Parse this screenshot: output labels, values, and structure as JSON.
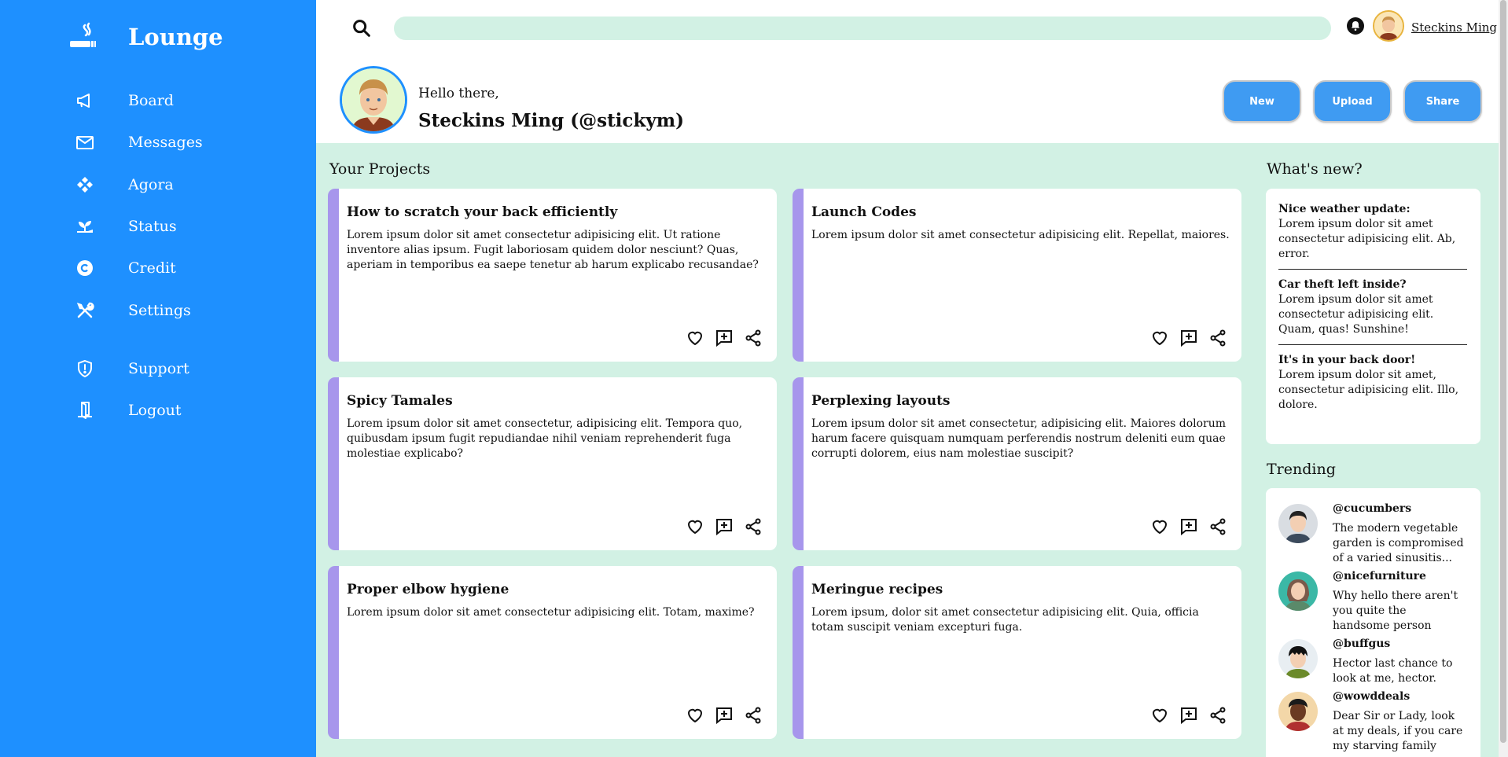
{
  "sidebar": {
    "brand": "Lounge",
    "items": [
      {
        "label": "Board",
        "icon": "megaphone-icon"
      },
      {
        "label": "Messages",
        "icon": "envelope-icon"
      },
      {
        "label": "Agora",
        "icon": "diamonds-icon"
      },
      {
        "label": "Status",
        "icon": "sprout-icon"
      },
      {
        "label": "Credit",
        "icon": "copyright-icon"
      },
      {
        "label": "Settings",
        "icon": "tools-icon"
      },
      {
        "label": "Support",
        "icon": "shield-icon"
      },
      {
        "label": "Logout",
        "icon": "door-icon"
      }
    ]
  },
  "topbar": {
    "search_placeholder": "",
    "username": "Steckins Ming"
  },
  "header": {
    "greeting": "Hello there,",
    "fullname": "Steckins Ming (@stickym)",
    "buttons": {
      "new": "New",
      "upload": "Upload",
      "share": "Share"
    }
  },
  "projects": {
    "title": "Your Projects",
    "cards": [
      {
        "title": "How to scratch your back efficiently",
        "body": "Lorem ipsum dolor sit amet consectetur adipisicing elit. Ut ratione inventore alias ipsum. Fugit laboriosam quidem dolor nesciunt? Quas, aperiam in temporibus ea saepe tenetur ab harum explicabo recusandae?"
      },
      {
        "title": "Launch Codes",
        "body": "Lorem ipsum dolor sit amet consectetur adipisicing elit. Repellat, maiores."
      },
      {
        "title": "Spicy Tamales",
        "body": "Lorem ipsum dolor sit amet consectetur, adipisicing elit. Tempora quo, quibusdam ipsum fugit repudiandae nihil veniam reprehenderit fuga molestiae explicabo?"
      },
      {
        "title": "Perplexing layouts",
        "body": "Lorem ipsum dolor sit amet consectetur, adipisicing elit. Maiores dolorum harum facere quisquam numquam perferendis nostrum deleniti eum quae corrupti dolorem, eius nam molestiae suscipit?"
      },
      {
        "title": "Proper elbow hygiene",
        "body": "Lorem ipsum dolor sit amet consectetur adipisicing elit. Totam, maxime?"
      },
      {
        "title": "Meringue recipes",
        "body": "Lorem ipsum, dolor sit amet consectetur adipisicing elit. Quia, officia totam suscipit veniam excepturi fuga."
      }
    ]
  },
  "news": {
    "title": "What's new?",
    "items": [
      {
        "heading": "Nice weather update:",
        "text": "Lorem ipsum dolor sit amet consectetur adipisicing elit. Ab, error."
      },
      {
        "heading": "Car theft left inside?",
        "text": "Lorem ipsum dolor sit amet consectetur adipisicing elit. Quam, quas! Sunshine!"
      },
      {
        "heading": "It's in your back door!",
        "text": "Lorem ipsum dolor sit amet, consectetur adipisicing elit. Illo, dolore."
      }
    ]
  },
  "trending": {
    "title": "Trending",
    "items": [
      {
        "handle": "@cucumbers",
        "text": "The modern vegetable garden is compromised of a varied sinusitis..."
      },
      {
        "handle": "@nicefurniture",
        "text": "Why hello there aren't you quite the handsome person"
      },
      {
        "handle": "@buffgus",
        "text": "Hector last chance to look at me, hector."
      },
      {
        "handle": "@wowddeals",
        "text": "Dear Sir or Lady, look at my deals, if you care my starving family"
      }
    ]
  },
  "colors": {
    "sidebar": "#1e90ff",
    "background": "#d2f1e4",
    "card_accent": "#a796ec",
    "button": "#3f9bf2"
  }
}
